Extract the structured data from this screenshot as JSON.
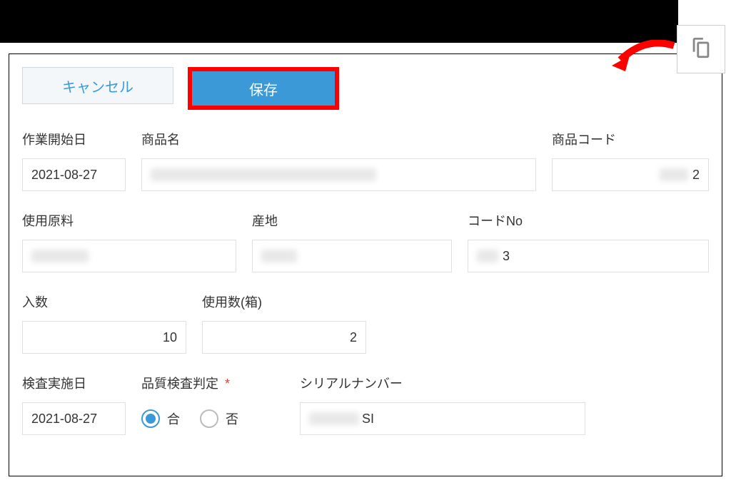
{
  "toolbar": {
    "cancel_label": "キャンセル",
    "save_label": "保存"
  },
  "fields": {
    "work_start_date": {
      "label": "作業開始日",
      "value": "2021-08-27"
    },
    "product_name": {
      "label": "商品名",
      "value": ""
    },
    "product_code": {
      "label": "商品コード",
      "value": "2"
    },
    "ingredient": {
      "label": "使用原料",
      "value": ""
    },
    "origin": {
      "label": "産地",
      "value": ""
    },
    "code_no": {
      "label": "コードNo",
      "value": "3"
    },
    "quantity_per": {
      "label": "入数",
      "value": "10"
    },
    "usage_count": {
      "label": "使用数(箱)",
      "value": "2"
    },
    "inspection_date": {
      "label": "検査実施日",
      "value": "2021-08-27"
    },
    "quality_judgment": {
      "label": "品質検査判定",
      "required": "*",
      "option_pass": "合",
      "option_fail": "否",
      "selected": "pass"
    },
    "serial_number": {
      "label": "シリアルナンバー",
      "value": "SI"
    }
  }
}
